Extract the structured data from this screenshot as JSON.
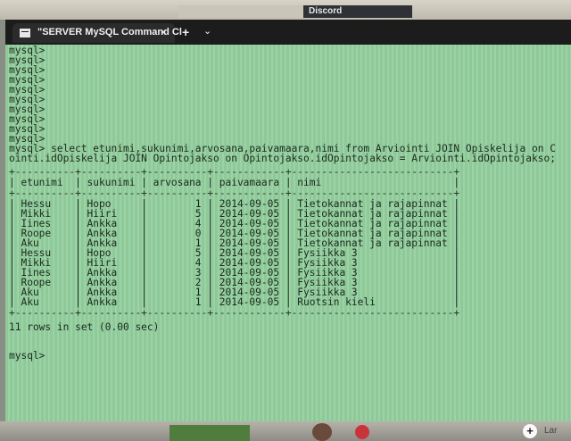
{
  "background": {
    "faded_tab": "",
    "discord_tab": "Discord"
  },
  "window": {
    "tab_title": "\"SERVER MySQL Command Cl",
    "close_glyph": "×",
    "new_tab_glyph": "+",
    "menu_glyph": "⌄"
  },
  "terminal": {
    "prompt_lines": [
      "mysql>",
      "mysql>",
      "mysql>",
      "mysql>",
      "mysql>",
      "mysql>",
      "mysql>",
      "mysql>",
      "mysql>",
      "mysql>"
    ],
    "query_line1": "mysql> select etunimi,sukunimi,arvosana,paivamaara,nimi from Arviointi JOIN Opiskelija on C",
    "query_line2": "ointi.idOpiskelija JOIN Opintojakso on Opintojakso.idOpintojakso = Arviointi.idOpintojakso;",
    "border_line": "+----------+----------+----------+------------+---------------------------+",
    "header": "| etunimi  | sukunimi | arvosana | paivamaara | nimi                      |",
    "columns": [
      "etunimi",
      "sukunimi",
      "arvosana",
      "paivamaara",
      "nimi"
    ],
    "rows": [
      [
        "Hessu",
        "Hopo",
        "1",
        "2014-09-05",
        "Tietokannat ja rajapinnat"
      ],
      [
        "Mikki",
        "Hiiri",
        "5",
        "2014-09-05",
        "Tietokannat ja rajapinnat"
      ],
      [
        "Iines",
        "Ankka",
        "4",
        "2014-09-05",
        "Tietokannat ja rajapinnat"
      ],
      [
        "Roope",
        "Ankka",
        "0",
        "2014-09-05",
        "Tietokannat ja rajapinnat"
      ],
      [
        "Aku",
        "Ankka",
        "1",
        "2014-09-05",
        "Tietokannat ja rajapinnat"
      ],
      [
        "Hessu",
        "Hopo",
        "5",
        "2014-09-05",
        "Fysiikka 3"
      ],
      [
        "Mikki",
        "Hiiri",
        "4",
        "2014-09-05",
        "Fysiikka 3"
      ],
      [
        "Iines",
        "Ankka",
        "3",
        "2014-09-05",
        "Fysiikka 3"
      ],
      [
        "Roope",
        "Ankka",
        "2",
        "2014-09-05",
        "Fysiikka 3"
      ],
      [
        "Aku",
        "Ankka",
        "1",
        "2014-09-05",
        "Fysiikka 3"
      ],
      [
        "Aku",
        "Ankka",
        "1",
        "2014-09-05",
        "Ruotsin kieli"
      ]
    ],
    "row_lines": [
      "| Hessu    | Hopo     |        1 | 2014-09-05 | Tietokannat ja rajapinnat |",
      "| Mikki    | Hiiri    |        5 | 2014-09-05 | Tietokannat ja rajapinnat |",
      "| Iines    | Ankka    |        4 | 2014-09-05 | Tietokannat ja rajapinnat |",
      "| Roope    | Ankka    |        0 | 2014-09-05 | Tietokannat ja rajapinnat |",
      "| Aku      | Ankka    |        1 | 2014-09-05 | Tietokannat ja rajapinnat |",
      "| Hessu    | Hopo     |        5 | 2014-09-05 | Fysiikka 3                |",
      "| Mikki    | Hiiri    |        4 | 2014-09-05 | Fysiikka 3                |",
      "| Iines    | Ankka    |        3 | 2014-09-05 | Fysiikka 3                |",
      "| Roope    | Ankka    |        2 | 2014-09-05 | Fysiikka 3                |",
      "| Aku      | Ankka    |        1 | 2014-09-05 | Fysiikka 3                |",
      "| Aku      | Ankka    |        1 | 2014-09-05 | Ruotsin kieli             |"
    ],
    "result_summary": "11 rows in set (0.00 sec)",
    "final_prompt": "mysql>"
  },
  "taskbar": {
    "plus_glyph": "+",
    "label": "Lar"
  }
}
